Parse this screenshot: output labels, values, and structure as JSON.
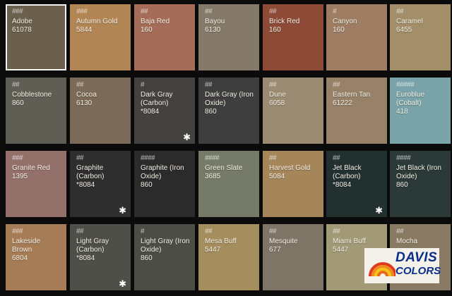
{
  "swatches": [
    {
      "name": "Adobe",
      "code": "61078",
      "price": "###",
      "color": "#6b5f4d",
      "selected": true,
      "star": false
    },
    {
      "name": "Autumn Gold",
      "code": "5844",
      "price": "###",
      "color": "#b28654",
      "selected": false,
      "star": false
    },
    {
      "name": "Baja Red",
      "code": "160",
      "price": "##",
      "color": "#a56d58",
      "selected": false,
      "star": false
    },
    {
      "name": "Bayou",
      "code": "6130",
      "price": "##",
      "color": "#85796a",
      "selected": false,
      "star": false
    },
    {
      "name": "Brick Red",
      "code": "160",
      "price": "##",
      "color": "#8c4a37",
      "selected": false,
      "star": false
    },
    {
      "name": "Canyon",
      "code": "160",
      "price": "#",
      "color": "#9e7d63",
      "selected": false,
      "star": false
    },
    {
      "name": "Caramel",
      "code": "6455",
      "price": "##",
      "color": "#a38e6a",
      "selected": false,
      "star": false
    },
    {
      "name": "Cobblestone",
      "code": "860",
      "price": "##",
      "color": "#5f5e55",
      "selected": false,
      "star": false
    },
    {
      "name": "Cocoa",
      "code": "6130",
      "price": "##",
      "color": "#7b6a57",
      "selected": false,
      "star": false
    },
    {
      "name": "Dark Gray (Carbon)",
      "code": "*8084",
      "price": "#",
      "color": "#434241",
      "selected": false,
      "star": true
    },
    {
      "name": "Dark Gray (Iron Oxide)",
      "code": "860",
      "price": "##",
      "color": "#3f3e3e",
      "selected": false,
      "star": false
    },
    {
      "name": "Dune",
      "code": "6058",
      "price": "##",
      "color": "#9b8b72",
      "selected": false,
      "star": false
    },
    {
      "name": "Eastern Tan",
      "code": "61222",
      "price": "##",
      "color": "#978269",
      "selected": false,
      "star": false
    },
    {
      "name": "Euroblue (Cobalt)",
      "code": "418",
      "price": "#####",
      "color": "#79a3a8",
      "selected": false,
      "star": false
    },
    {
      "name": "Granite Red",
      "code": "1395",
      "price": "###",
      "color": "#94706b",
      "selected": false,
      "star": false
    },
    {
      "name": "Graphite (Carbon)",
      "code": "*8084",
      "price": "##",
      "color": "#2e2e2e",
      "selected": false,
      "star": true
    },
    {
      "name": "Graphite (Iron Oxide)",
      "code": "860",
      "price": "####",
      "color": "#2b2b2b",
      "selected": false,
      "star": false
    },
    {
      "name": "Green Slate",
      "code": "3685",
      "price": "####",
      "color": "#767a69",
      "selected": false,
      "star": false
    },
    {
      "name": "Harvest Gold",
      "code": "5084",
      "price": "##",
      "color": "#a5865b",
      "selected": false,
      "star": false
    },
    {
      "name": "Jet Black (Carbon)",
      "code": "*8084",
      "price": "##",
      "color": "#223030",
      "selected": false,
      "star": true
    },
    {
      "name": "Jet Black (Iron Oxide)",
      "code": "860",
      "price": "####",
      "color": "#2b3a38",
      "selected": false,
      "star": false
    },
    {
      "name": "Lakeside Brown",
      "code": "6804",
      "price": "###",
      "color": "#a67c56",
      "selected": false,
      "star": false
    },
    {
      "name": "Light Gray (Carbon)",
      "code": "*8084",
      "price": "##",
      "color": "#4e4f48",
      "selected": false,
      "star": true
    },
    {
      "name": "Light Gray (Iron Oxide)",
      "code": "860",
      "price": "#",
      "color": "#4d4d48",
      "selected": false,
      "star": false
    },
    {
      "name": "Mesa Buff",
      "code": "5447",
      "price": "##",
      "color": "#a58e5e",
      "selected": false,
      "star": false
    },
    {
      "name": "Mesquite",
      "code": "677",
      "price": "##",
      "color": "#7e7566",
      "selected": false,
      "star": false
    },
    {
      "name": "Miami Buff",
      "code": "5447",
      "price": "##",
      "color": "#a29a76",
      "selected": false,
      "star": false
    },
    {
      "name": "Mocha",
      "code": "",
      "price": "##",
      "color": "#897a63",
      "selected": false,
      "star": false
    }
  ],
  "logo": {
    "line1": "DAVIS",
    "line2": "COLORS",
    "text_color": "#0a2d8c"
  },
  "star_glyph": "✱"
}
